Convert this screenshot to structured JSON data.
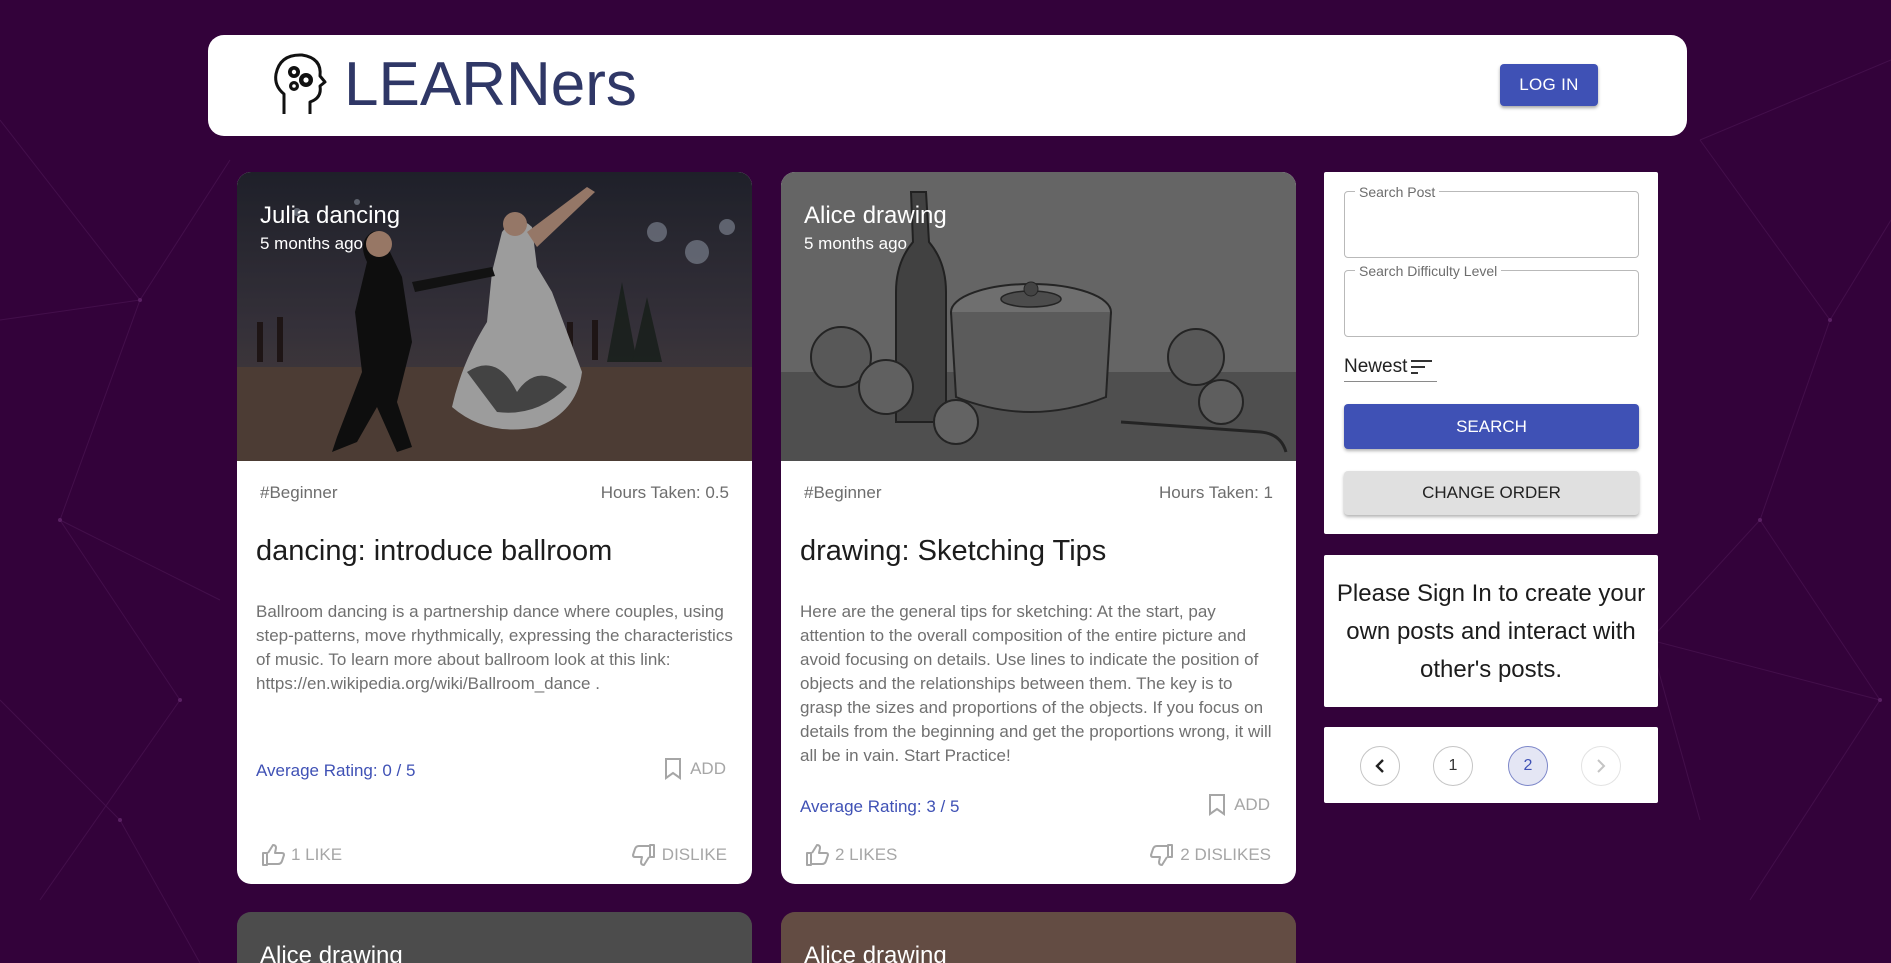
{
  "header": {
    "brand": "LEARNers",
    "login_label": "LOG IN"
  },
  "posts": [
    {
      "author_title": "Julia dancing",
      "time": "5 months ago",
      "tag": "#Beginner",
      "hours": "Hours Taken: 0.5",
      "title": "dancing: introduce ballroom",
      "body": "Ballroom dancing is a partnership dance where couples, using step-patterns, move rhythmically, expressing the characteristics of music. To learn more about ballroom look at this link: https://en.wikipedia.org/wiki/Ballroom_dance .",
      "rating_label": "Average Rating: ",
      "rating_value": "0 / 5",
      "add_label": "ADD",
      "likes": "1 LIKE",
      "dislikes": "DISLIKE"
    },
    {
      "author_title": "Alice drawing",
      "time": "5 months ago",
      "tag": "#Beginner",
      "hours": "Hours Taken: 1",
      "title": "drawing: Sketching Tips",
      "body": "Here are the general tips for sketching: At the start, pay attention to the overall composition of the entire picture and avoid focusing on details. Use lines to indicate the position of objects and the relationships between them. The key is to grasp the sizes and proportions of the objects. If you focus on details from the beginning and get the proportions wrong, it will all be in vain. Start Practice!",
      "rating_label": "Average Rating: ",
      "rating_value": "3 / 5",
      "add_label": "ADD",
      "likes": "2 LIKES",
      "dislikes": "2 DISLIKES"
    }
  ],
  "peek_posts": [
    {
      "author_title": "Alice drawing"
    },
    {
      "author_title": "Alice drawing"
    }
  ],
  "sidebar": {
    "search_post_label": "Search Post",
    "search_post_value": "",
    "search_level_label": "Search Difficulty Level",
    "search_level_value": "",
    "sort_value": "Newest",
    "search_label": "SEARCH",
    "change_order_label": "CHANGE ORDER",
    "signin_message": "Please Sign In to create your own posts and interact with other's posts.",
    "pagination": {
      "pages": [
        "1",
        "2"
      ],
      "current": "2"
    }
  },
  "colors": {
    "background": "#33023a",
    "primary": "#3f51b5",
    "brand_text": "#2f3766"
  }
}
